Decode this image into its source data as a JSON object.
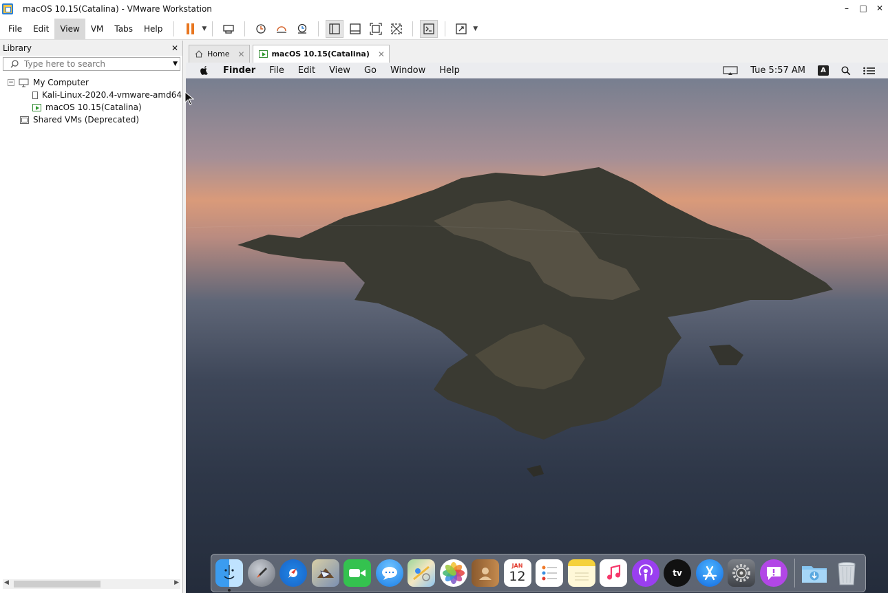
{
  "window": {
    "title": "macOS 10.15(Catalina) - VMware Workstation",
    "minimize": "–",
    "maximize": "□",
    "close": "✕"
  },
  "menu": [
    "File",
    "Edit",
    "View",
    "VM",
    "Tabs",
    "Help"
  ],
  "menu_active": "View",
  "library": {
    "title": "Library",
    "close": "✕",
    "search_placeholder": "Type here to search",
    "tree": {
      "root": "My Computer",
      "expander": "−",
      "vms": [
        "Kali-Linux-2020.4-vmware-amd64",
        "macOS 10.15(Catalina)"
      ],
      "shared": "Shared VMs (Deprecated)"
    }
  },
  "tabs": [
    {
      "label": "Home",
      "close": "✕"
    },
    {
      "label": "macOS 10.15(Catalina)",
      "close": "✕"
    }
  ],
  "guest": {
    "menus": [
      "Finder",
      "File",
      "Edit",
      "View",
      "Go",
      "Window",
      "Help"
    ],
    "clock": "Tue 5:57 AM",
    "input_source": "A"
  },
  "dock": {
    "calendar_month": "JAN",
    "calendar_day": "12",
    "apps": [
      "finder-icon",
      "launchpad-icon",
      "safari-icon",
      "mail-icon",
      "facetime-icon",
      "messages-icon",
      "maps-icon",
      "photos-icon",
      "contacts-icon",
      "calendar-icon",
      "reminders-icon",
      "notes-icon",
      "music-icon",
      "podcasts-icon",
      "apple-tv-icon",
      "app-store-icon",
      "system-preferences-icon",
      "feedback-assistant-icon",
      "downloads-folder-icon",
      "trash-icon"
    ]
  },
  "colors": {
    "accent": "#e8761f",
    "running": "#2d9a2d"
  }
}
